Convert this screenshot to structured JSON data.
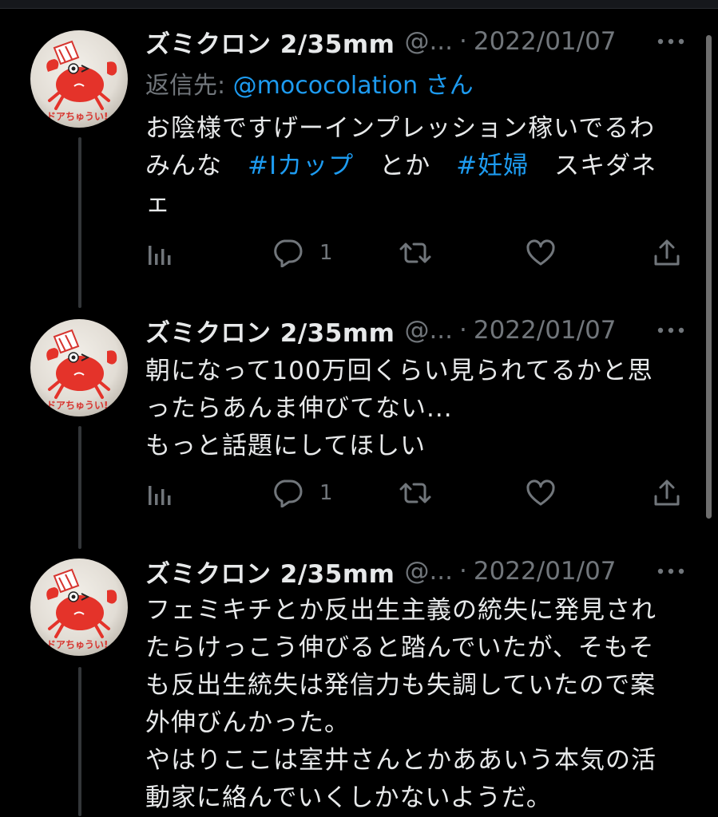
{
  "tweets": [
    {
      "name": "ズミクロン 2/35mm",
      "handle": "@...",
      "separator": "·",
      "date": "2022/01/07",
      "reply_prefix": "返信先: ",
      "reply_mention": "@mococolation",
      "reply_suffix": " さん",
      "lines": [
        [
          "お陰様ですげーインプレッション稼いでるわ"
        ],
        [
          "みんな　",
          "#Iカップ",
          "　とか　",
          "#妊婦",
          "　スキダネ"
        ],
        [
          "ェ"
        ]
      ],
      "replies": "1"
    },
    {
      "name": "ズミクロン 2/35mm",
      "handle": "@...",
      "separator": "·",
      "date": "2022/01/07",
      "lines": [
        [
          "朝になって100万回くらい見られてるかと思"
        ],
        [
          "ったらあんま伸びてない..."
        ],
        [
          "もっと話題にしてほしい"
        ]
      ],
      "replies": "1"
    },
    {
      "name": "ズミクロン 2/35mm",
      "handle": "@...",
      "separator": "·",
      "date": "2022/01/07",
      "lines": [
        [
          "フェミキチとか反出生主義の統失に発見され"
        ],
        [
          "たらけっこう伸びると踏んでいたが、そもそ"
        ],
        [
          "も反出生統失は発信力も失調していたので案"
        ],
        [
          "外伸びんかった。"
        ],
        [
          "やはりここは室井さんとかああいう本気の活"
        ],
        [
          "動家に絡んでいくしかないようだ。"
        ]
      ]
    }
  ],
  "avatar_text": "ドアちゅうい!",
  "icons": {
    "views": "bar-chart-icon",
    "reply": "speech-bubble-icon",
    "retweet": "retweet-icon",
    "like": "heart-icon",
    "share": "share-icon",
    "more": "more-dots-icon"
  },
  "colors": {
    "background": "#000000",
    "text": "#e7e9ea",
    "muted": "#71767b",
    "link": "#1d9bf0",
    "thread_line": "#333639"
  }
}
